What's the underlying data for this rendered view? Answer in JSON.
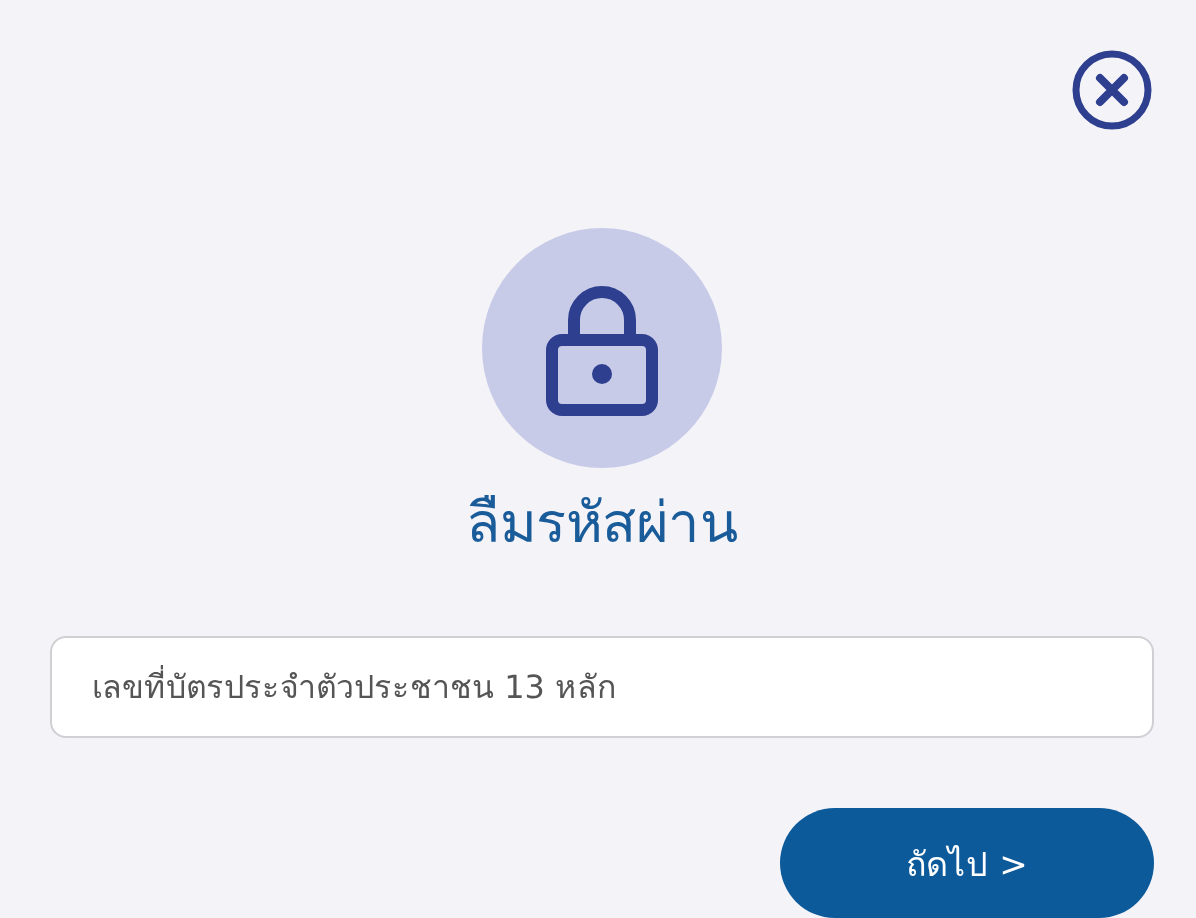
{
  "title": "ลืมรหัสผ่าน",
  "id_field": {
    "placeholder": "เลขที่บัตรประจำตัวประชาชน 13 หลัก"
  },
  "next_button": {
    "label": "ถัดไป >"
  }
}
